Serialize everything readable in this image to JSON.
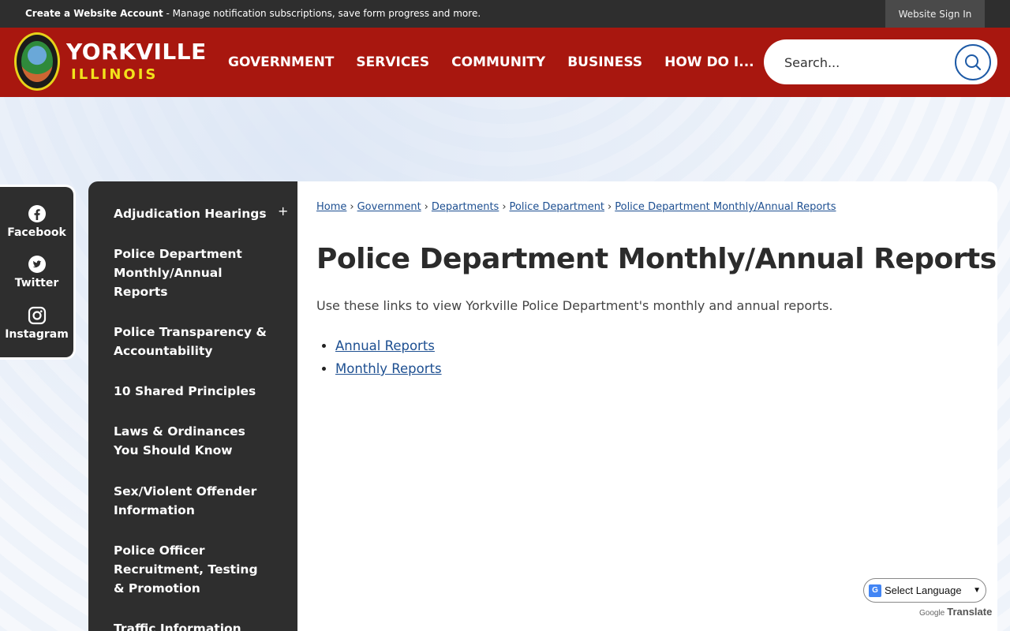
{
  "topbar": {
    "account_link": "Create a Website Account",
    "account_desc": " - Manage notification subscriptions, save form progress and more.",
    "signin": "Website Sign In"
  },
  "header": {
    "logo_title": "YORKVILLE",
    "logo_subtitle": "ILLINOIS",
    "nav": [
      "GOVERNMENT",
      "SERVICES",
      "COMMUNITY",
      "BUSINESS",
      "HOW DO I..."
    ],
    "search_placeholder": "Search..."
  },
  "social": [
    {
      "label": "Facebook",
      "icon": "facebook-icon"
    },
    {
      "label": "Twitter",
      "icon": "twitter-icon"
    },
    {
      "label": "Instagram",
      "icon": "instagram-icon"
    }
  ],
  "sidenav": {
    "items": [
      "Adjudication Hearings",
      "Police Department Monthly/Annual Reports",
      "Police Transparency & Accountability",
      "10 Shared Principles",
      "Laws & Ordinances You Should Know",
      "Sex/Violent Offender Information",
      "Police Officer Recruitment, Testing & Promotion",
      "Traffic Information"
    ],
    "expand_symbol": "+"
  },
  "breadcrumb": [
    "Home",
    "Government",
    "Departments",
    "Police Department",
    "Police Department Monthly/Annual Reports"
  ],
  "main": {
    "title": "Police Department Monthly/Annual Reports",
    "intro": "Use these links to view Yorkville Police Department's monthly and annual reports.",
    "links": [
      "Annual Reports",
      "Monthly Reports"
    ]
  },
  "translate": {
    "select_label": "Select Language",
    "powered_by": "Google",
    "translate_label": "Translate"
  },
  "colors": {
    "header_red": "#a8170f",
    "dark": "#2e2e2e",
    "link_blue": "#1d4f91",
    "logo_yellow": "#f2e21b"
  }
}
